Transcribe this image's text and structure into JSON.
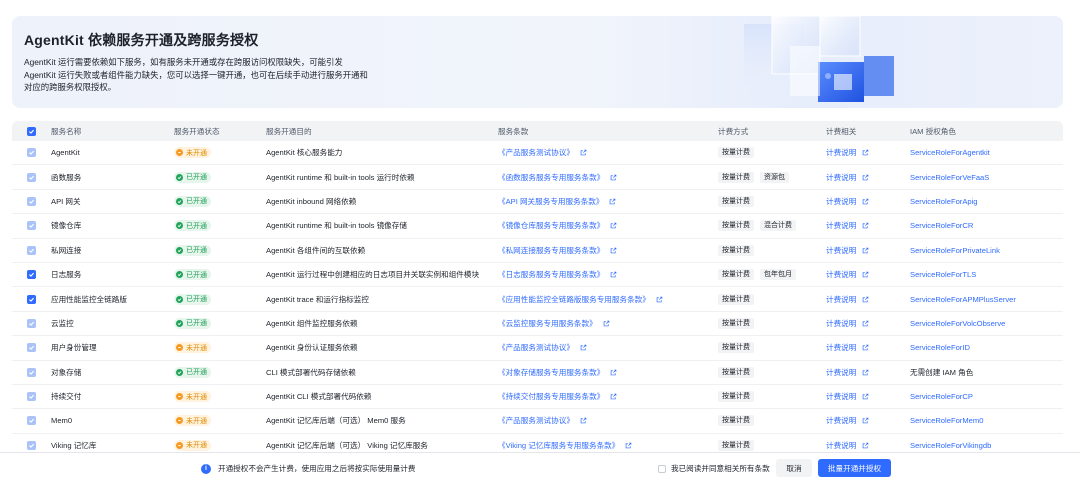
{
  "banner": {
    "title": "AgentKit 依赖服务开通及跨服务授权",
    "description": "AgentKit 运行需要依赖如下服务，如有服务未开通或存在跨服访问权限缺失，可能引发 AgentKit 运行失败或者组件能力缺失，您可以选择一键开通，也可在后续手动进行服务开通和对应的跨服务权限授权。"
  },
  "table": {
    "headers": {
      "name": "服务名称",
      "status": "服务开通状态",
      "purpose": "服务开通目的",
      "terms": "服务条款",
      "billing": "计费方式",
      "billing_related": "计费相关",
      "iam": "IAM 授权角色"
    },
    "status_labels": {
      "on": "已开通",
      "off": "未开通"
    },
    "rows": [
      {
        "name": "AgentKit",
        "status": "off",
        "status_text": "未开通",
        "purpose": "AgentKit 核心服务能力",
        "terms": "《产品服务测试协议》",
        "billing": [
          "按量计费"
        ],
        "billing_related": "计费说明",
        "iam": "ServiceRoleForAgentkit",
        "iam_link": true,
        "checked": "dim"
      },
      {
        "name": "函数服务",
        "status": "on",
        "status_text": "已开通",
        "purpose": "AgentKit runtime 和 built-in tools 运行时依赖",
        "terms": "《函数服务服务专用服务条款》",
        "billing": [
          "按量计费",
          "资源包"
        ],
        "billing_related": "计费说明",
        "iam": "ServiceRoleForVeFaaS",
        "iam_link": true,
        "checked": "dim"
      },
      {
        "name": "API 网关",
        "status": "on",
        "status_text": "已开通",
        "purpose": "AgentKit inbound 网络依赖",
        "terms": "《API 网关服务专用服务条款》",
        "billing": [
          "按量计费"
        ],
        "billing_related": "计费说明",
        "iam": "ServiceRoleForApig",
        "iam_link": true,
        "checked": "dim"
      },
      {
        "name": "镜像仓库",
        "status": "on",
        "status_text": "已开通",
        "purpose": "AgentKit runtime 和 built-in tools 镜像存储",
        "terms": "《镜像仓库服务专用服务条款》",
        "billing": [
          "按量计费",
          "混合计费"
        ],
        "billing_related": "计费说明",
        "iam": "ServiceRoleForCR",
        "iam_link": true,
        "checked": "dim"
      },
      {
        "name": "私网连接",
        "status": "on",
        "status_text": "已开通",
        "purpose": "AgentKit 各组件间的互联依赖",
        "terms": "《私网连接服务专用服务条款》",
        "billing": [
          "按量计费"
        ],
        "billing_related": "计费说明",
        "iam": "ServiceRoleForPrivateLink",
        "iam_link": true,
        "checked": "dim"
      },
      {
        "name": "日志服务",
        "status": "on",
        "status_text": "已开通",
        "purpose": "AgentKit 运行过程中创建相应的日志项目并关联实例和组件模块",
        "terms": "《日志服务服务专用服务条款》",
        "billing": [
          "按量计费",
          "包年包月"
        ],
        "billing_related": "计费说明",
        "iam": "ServiceRoleForTLS",
        "iam_link": true,
        "checked": "full"
      },
      {
        "name": "应用性能监控全链路版",
        "status": "on",
        "status_text": "已开通",
        "purpose": "AgentKit trace 和运行指标监控",
        "terms": "《应用性能监控全链路版服务专用服务条款》",
        "billing": [
          "按量计费"
        ],
        "billing_related": "计费说明",
        "iam": "ServiceRoleForAPMPlusServer",
        "iam_link": true,
        "checked": "full"
      },
      {
        "name": "云监控",
        "status": "on",
        "status_text": "已开通",
        "purpose": "AgentKit 组件监控服务依赖",
        "terms": "《云监控服务专用服务条款》",
        "billing": [
          "按量计费"
        ],
        "billing_related": "计费说明",
        "iam": "ServiceRoleForVolcObserve",
        "iam_link": true,
        "checked": "dim"
      },
      {
        "name": "用户身份管理",
        "status": "off",
        "status_text": "未开通",
        "purpose": "AgentKit 身份认证服务依赖",
        "terms": "《产品服务测试协议》",
        "billing": [
          "按量计费"
        ],
        "billing_related": "计费说明",
        "iam": "ServiceRoleForID",
        "iam_link": true,
        "checked": "dim"
      },
      {
        "name": "对象存储",
        "status": "on",
        "status_text": "已开通",
        "purpose": "CLI 模式部署代码存储依赖",
        "terms": "《对象存储服务专用服务条款》",
        "billing": [
          "按量计费"
        ],
        "billing_related": "计费说明",
        "iam": "无需创建 IAM 角色",
        "iam_link": false,
        "checked": "dim"
      },
      {
        "name": "持续交付",
        "status": "off",
        "status_text": "未开通",
        "purpose": "AgentKit CLI 模式部署代码依赖",
        "terms": "《持续交付服务专用服务条款》",
        "billing": [
          "按量计费"
        ],
        "billing_related": "计费说明",
        "iam": "ServiceRoleForCP",
        "iam_link": true,
        "checked": "dim"
      },
      {
        "name": "Mem0",
        "status": "off",
        "status_text": "未开通",
        "purpose": "AgentKit 记忆库后端（可选） Mem0 服务",
        "terms": "《产品服务测试协议》",
        "billing": [
          "按量计费"
        ],
        "billing_related": "计费说明",
        "iam": "ServiceRoleForMem0",
        "iam_link": true,
        "checked": "dim"
      },
      {
        "name": "Viking 记忆库",
        "status": "off",
        "status_text": "未开通",
        "purpose": "AgentKit 记忆库后端（可选） Viking 记忆库服务",
        "terms": "《Viking 记忆库服务专用服务条款》",
        "billing": [
          "按量计费"
        ],
        "billing_related": "计费说明",
        "iam": "ServiceRoleForVikingdb",
        "iam_link": true,
        "checked": "dim"
      }
    ]
  },
  "footer": {
    "notice": "开通授权不会产生计费，使用应用之后将按实际使用量计费",
    "agree": "我已阅读并同意相关所有条款",
    "cancel": "取消",
    "confirm": "批量开通并授权"
  },
  "colors": {
    "primary": "#2f6bff",
    "enabled": "#22a35a",
    "disabled": "#f59a23"
  }
}
